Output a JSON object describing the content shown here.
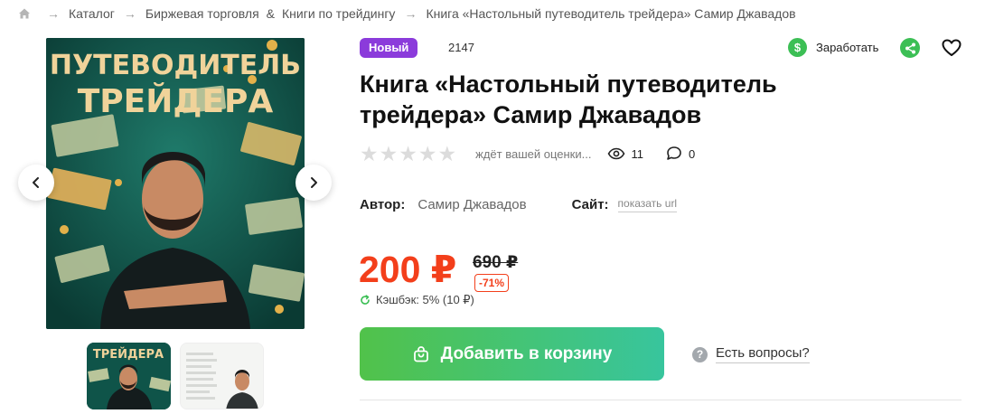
{
  "breadcrumb": {
    "items": [
      "Каталог",
      "Биржевая торговля",
      "Книги по трейдингу",
      "Книга «Настольный путеводитель трейдера» Самир Джавадов"
    ],
    "separator": "&"
  },
  "gallery": {
    "cover_title_line1": "ПУТЕВОДИТЕЛЬ",
    "cover_title_line2": "ТРЕЙДЕРА",
    "thumb_text": "ТРЕЙДЕРА"
  },
  "product": {
    "badge": "Новый",
    "id": "2147",
    "title": "Книга «Настольный путеводитель трейдера» Самир Джавадов",
    "rating_text": "ждёт вашей оценки...",
    "rating_value": 0,
    "rating_max": 5,
    "views": "11",
    "comments": "0",
    "author_label": "Автор:",
    "author_name": "Самир Джавадов",
    "site_label": "Сайт:",
    "site_link": "показать url",
    "price": "200 ₽",
    "old_price": "690 ₽",
    "discount": "-71%",
    "cashback": "Кэшбэк: 5% (10 ₽)"
  },
  "actions": {
    "earn_label": "Заработать",
    "add_to_cart": "Добавить в корзину",
    "questions": "Есть вопросы?"
  },
  "colors": {
    "accent_price": "#f33f1b",
    "badge_new": "#8b3bdb",
    "cart_gradient_start": "#51c24a",
    "cart_gradient_end": "#38c59d",
    "earn_green": "#3cbf55"
  },
  "icons": [
    "home-icon",
    "dollar-icon",
    "share-icon",
    "heart-icon",
    "star-icon",
    "eye-icon",
    "comment-icon",
    "refresh-icon",
    "bag-icon",
    "question-icon",
    "chevron-left-icon",
    "chevron-right-icon"
  ]
}
